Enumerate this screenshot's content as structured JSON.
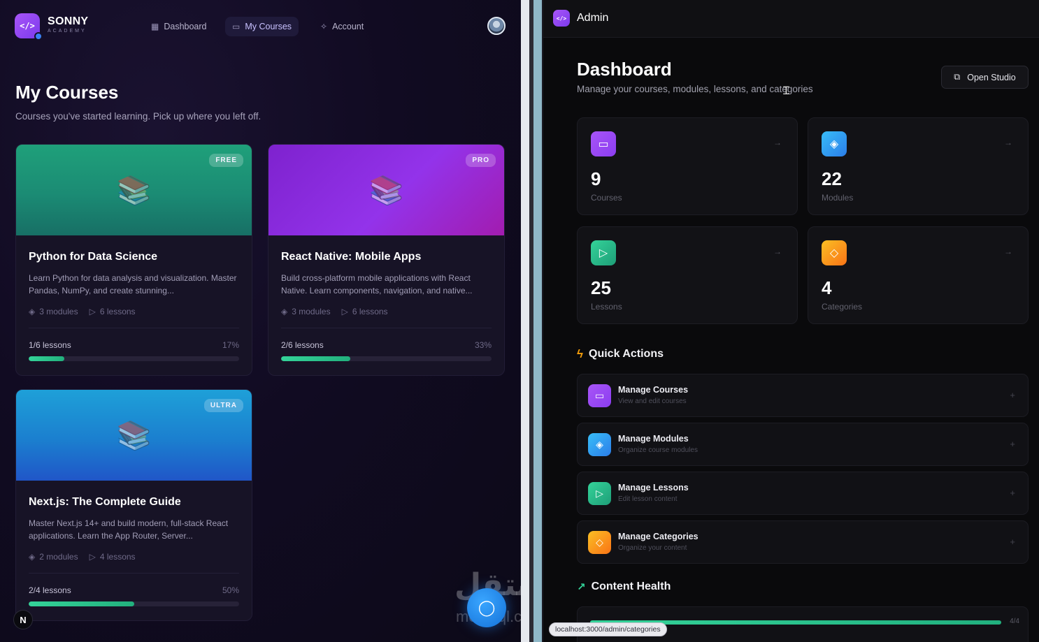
{
  "student": {
    "brand": {
      "name": "SONNY",
      "sub": "ACADEMY",
      "logo_glyph": "</>"
    },
    "nav": [
      {
        "label": "Dashboard",
        "icon": "grid-icon",
        "glyph": "▦"
      },
      {
        "label": "My Courses",
        "icon": "book-open-icon",
        "glyph": "▭"
      },
      {
        "label": "Account",
        "icon": "sparkles-icon",
        "glyph": "✧"
      }
    ],
    "page": {
      "title": "My Courses",
      "subtitle": "Courses you've started learning. Pick up where you left off."
    },
    "courses": [
      {
        "tier": "FREE",
        "title": "Python for Data Science",
        "description": "Learn Python for data analysis and visualization. Master Pandas, NumPy, and create stunning...",
        "modules": "3 modules",
        "lessons": "6 lessons",
        "progress_label": "1/6 lessons",
        "progress_pct": "17%",
        "progress_value": 0.17,
        "banner_color": "#1b8b74"
      },
      {
        "tier": "PRO",
        "title": "React Native: Mobile Apps",
        "description": "Build cross-platform mobile applications with React Native. Learn components, navigation, and native...",
        "modules": "3 modules",
        "lessons": "6 lessons",
        "progress_label": "2/6 lessons",
        "progress_pct": "33%",
        "progress_value": 0.33,
        "banner_color": "#9333ea"
      },
      {
        "tier": "ULTRA",
        "title": "Next.js: The Complete Guide",
        "description": "Master Next.js 14+ and build modern, full-stack React applications. Learn the App Router, Server...",
        "modules": "2 modules",
        "lessons": "4 lessons",
        "progress_label": "2/4 lessons",
        "progress_pct": "50%",
        "progress_value": 0.5,
        "banner_color": "#1b7fcf"
      }
    ],
    "misc": {
      "n_badge": "N",
      "watermark": "مستقل",
      "watermark_sub": "mostaql.com"
    }
  },
  "admin": {
    "title": "Admin",
    "logo_glyph": "</>",
    "dashboard": {
      "title": "Dashboard",
      "subtitle": "Manage your courses, modules, lessons, and categories",
      "open_studio": "Open Studio"
    },
    "stats": [
      {
        "value": "9",
        "label": "Courses",
        "icon": "book-open-icon",
        "glyph": "▭",
        "color": "#a855f7"
      },
      {
        "value": "22",
        "label": "Modules",
        "icon": "layers-icon",
        "glyph": "◈",
        "color": "#38bdf8"
      },
      {
        "value": "25",
        "label": "Lessons",
        "icon": "play-circle-icon",
        "glyph": "▷",
        "color": "#34d399"
      },
      {
        "value": "4",
        "label": "Categories",
        "icon": "tag-icon",
        "glyph": "◇",
        "color": "#f97316"
      }
    ],
    "quick_actions": {
      "heading": "Quick Actions",
      "items": [
        {
          "title": "Manage Courses",
          "sub": "View and edit courses",
          "icon": "book-open-icon",
          "glyph": "▭"
        },
        {
          "title": "Manage Modules",
          "sub": "Organize course modules",
          "icon": "layers-icon",
          "glyph": "◈"
        },
        {
          "title": "Manage Lessons",
          "sub": "Edit lesson content",
          "icon": "play-circle-icon",
          "glyph": "▷"
        },
        {
          "title": "Manage Categories",
          "sub": "Organize your content",
          "icon": "tag-icon",
          "glyph": "◇"
        }
      ]
    },
    "content_health": {
      "heading": "Content Health",
      "count": "4/4",
      "value": 1.0
    },
    "status_url": "localhost:3000/admin/categories"
  }
}
